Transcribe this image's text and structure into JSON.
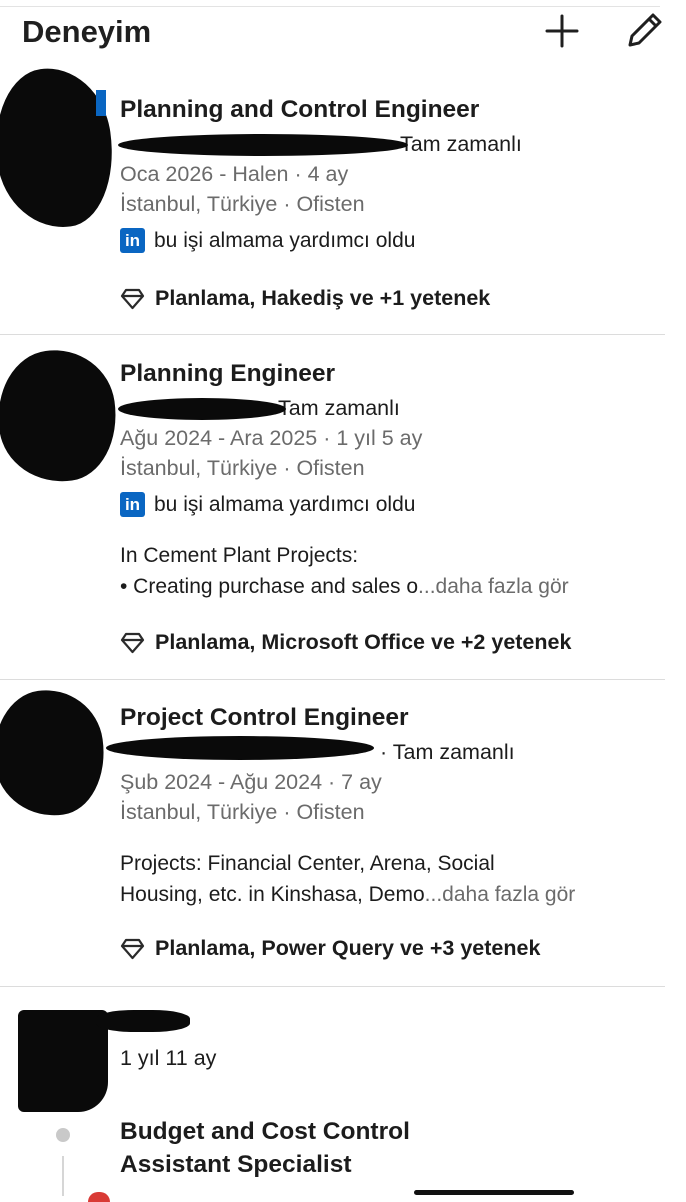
{
  "header": {
    "title": "Deneyim",
    "add_icon": "plus-icon",
    "edit_icon": "pencil-icon"
  },
  "experiences": [
    {
      "title": "Planning and Control Engineer",
      "employment_type": "Tam zamanlı",
      "dates": "Oca 2026 - Halen · 4 ay",
      "location": "İstanbul, Türkiye · Ofisten",
      "linkedin_note": "bu işi almama yardımcı oldu",
      "skills": "Planlama, Hakediş ve +1 yetenek"
    },
    {
      "title": "Planning Engineer",
      "employment_type": "Tam zamanlı",
      "dates": "Ağu 2024 - Ara 2025 · 1 yıl 5 ay",
      "location": "İstanbul, Türkiye · Ofisten",
      "linkedin_note": "bu işi almama yardımcı oldu",
      "description_line1": "In Cement Plant Projects:",
      "description_line2": "• Creating purchase and sales o",
      "see_more": "...daha fazla gör",
      "skills": "Planlama, Microsoft Office ve +2 yetenek"
    },
    {
      "title": "Project Control Engineer",
      "employment_type": "· Tam zamanlı",
      "dates": "Şub 2024 - Ağu 2024 · 7 ay",
      "location": "İstanbul, Türkiye · Ofisten",
      "description_line1": "Projects: Financial Center, Arena, Social",
      "description_line2": "Housing, etc. in Kinshasa, Demo",
      "see_more": "...daha fazla gör",
      "skills": "Planlama, Power Query ve +3 yetenek"
    }
  ],
  "grouped_company": {
    "duration": "1 yıl 11 ay",
    "roles": [
      {
        "title_line1": "Budget and Cost Control",
        "title_line2": "Assistant Specialist"
      }
    ]
  },
  "colors": {
    "linkedin_blue": "#0a66c2",
    "muted_text": "#6b6b6b",
    "divider": "#dcdcdc"
  }
}
